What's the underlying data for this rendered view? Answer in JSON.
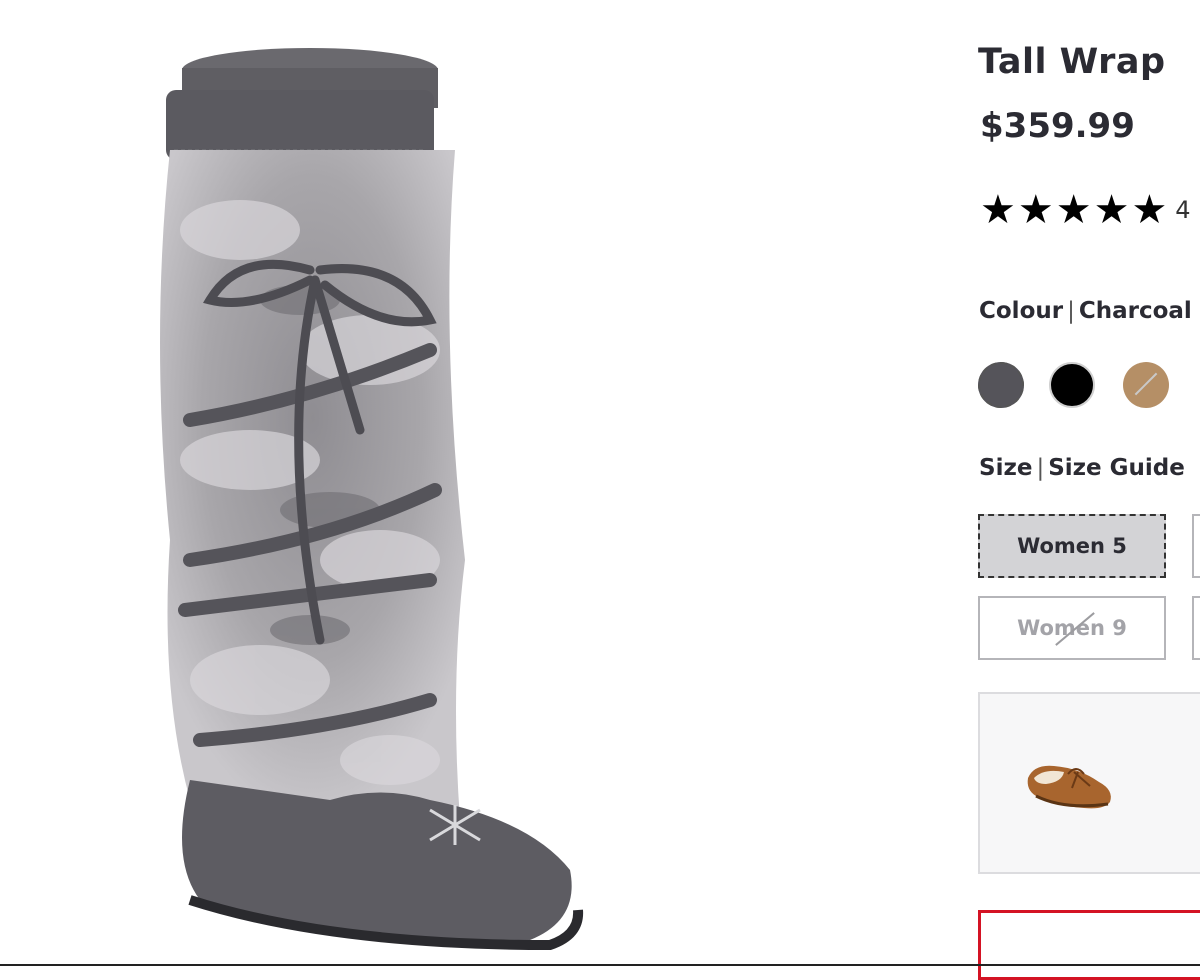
{
  "product": {
    "title": "Tall Wrap",
    "price": "$359.99",
    "image_alt": "charcoal-fur-wrap-boot",
    "rating": {
      "stars": 5,
      "count_text": "4"
    }
  },
  "colour": {
    "label": "Colour",
    "separator": "|",
    "selected": "Charcoal",
    "swatches": [
      {
        "name": "charcoal",
        "color": "#55545a",
        "selected": true,
        "available": true
      },
      {
        "name": "black",
        "color": "#000000",
        "selected": false,
        "available": true
      },
      {
        "name": "tan",
        "color": "#b58f66",
        "selected": false,
        "available": false
      }
    ]
  },
  "size": {
    "label": "Size",
    "separator": "|",
    "guide_link": "Size Guide",
    "options": [
      {
        "label": "Women 5",
        "selected": true,
        "available": true
      },
      {
        "label": "",
        "selected": false,
        "available": true
      },
      {
        "label": "Women 9",
        "selected": false,
        "available": false
      },
      {
        "label": "",
        "selected": false,
        "available": true
      }
    ]
  },
  "recommendation": {
    "image": "brown-moccasin-slipper"
  },
  "colors": {
    "accent_red": "#d41324",
    "text": "#2b2b33"
  }
}
